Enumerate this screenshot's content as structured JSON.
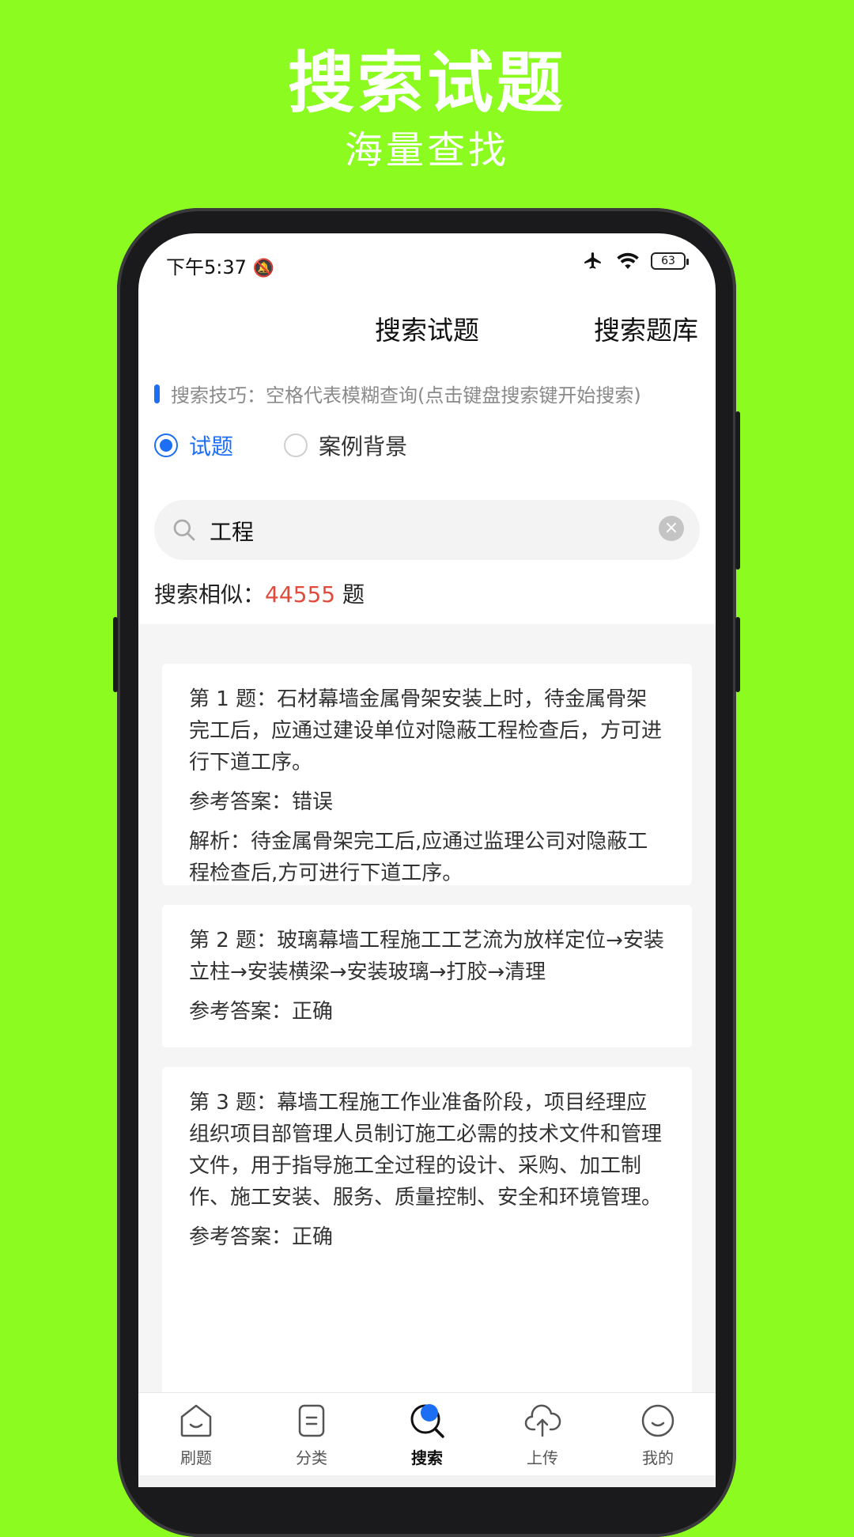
{
  "promo": {
    "title": "搜索试题",
    "subtitle": "海量查找"
  },
  "status_bar": {
    "time": "下午5:37",
    "battery": "63"
  },
  "header": {
    "title": "搜索试题",
    "right_action": "搜索题库"
  },
  "tip": {
    "text": "搜索技巧：空格代表模糊查询(点击键盘搜索键开始搜索)"
  },
  "filters": [
    {
      "label": "试题",
      "checked": true
    },
    {
      "label": "案例背景",
      "checked": false
    }
  ],
  "search": {
    "value": "工程",
    "placeholder": ""
  },
  "results": {
    "prefix": "搜索相似：",
    "count": "44555",
    "suffix": " 题"
  },
  "questions": [
    {
      "question": "第 1 题：石材幕墙金属骨架安装上时，待金属骨架完工后，应通过建设单位对隐蔽工程检查后，方可进行下道工序。",
      "answer": "参考答案：错误",
      "analysis": "解析：待金属骨架完工后,应通过监理公司对隐蔽工程检查后,方可进行下道工序。"
    },
    {
      "question": "第 2 题：玻璃幕墙工程施工工艺流为放样定位→安装立柱→安装横梁→安装玻璃→打胶→清理",
      "answer": "参考答案：正确"
    },
    {
      "question": "第 3 题：幕墙工程施工作业准备阶段，项目经理应组织项目部管理人员制订施工必需的技术文件和管理文件，用于指导施工全过程的设计、采购、加工制作、施工安装、服务、质量控制、安全和环境管理。",
      "answer": "参考答案：正确"
    }
  ],
  "bottom_nav": [
    {
      "label": "刷题",
      "icon": "home-face-icon"
    },
    {
      "label": "分类",
      "icon": "category-icon"
    },
    {
      "label": "搜索",
      "icon": "search-icon",
      "active": true
    },
    {
      "label": "上传",
      "icon": "cloud-upload-icon"
    },
    {
      "label": "我的",
      "icon": "profile-face-icon"
    }
  ],
  "colors": {
    "background": "#8cfb1f",
    "accent": "#1c6ef3",
    "count": "#e04b3b"
  }
}
